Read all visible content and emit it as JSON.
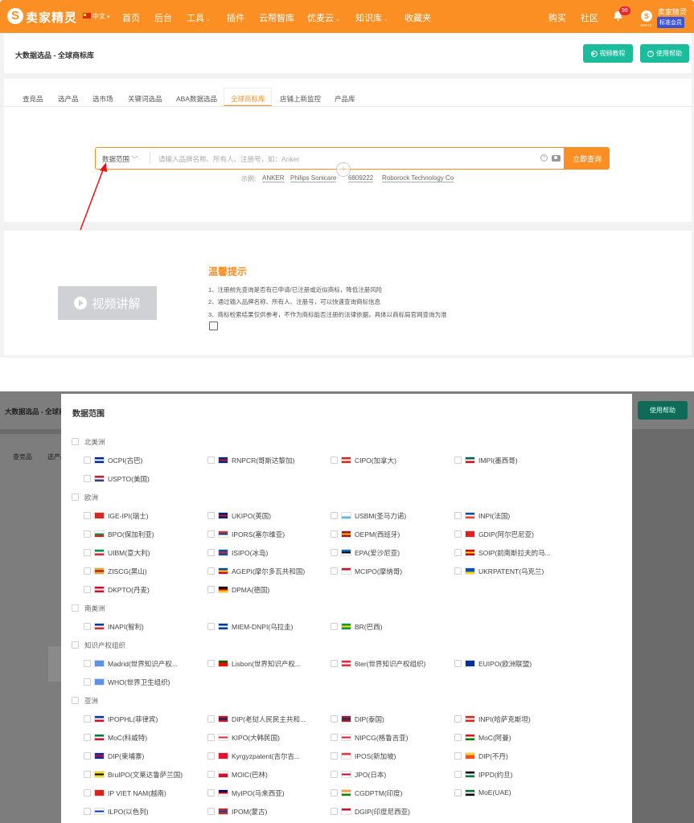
{
  "nav": {
    "logo_mark": "S",
    "logo_text": "卖家精灵",
    "language": "中文",
    "items": [
      "首页",
      "后台",
      "工具",
      "插件",
      "云帮智库",
      "优麦云",
      "知识库",
      "收藏夹"
    ],
    "right_items": [
      "购买",
      "社区"
    ],
    "notification_count": "99",
    "seller_logo_text": "SPRITE",
    "user_name": "卖家精灵",
    "member_badge": "标准会员"
  },
  "page": {
    "breadcrumb": "大数据选品 - 全球商标库",
    "btn_tutorial": "视频教程",
    "btn_help": "使用帮助",
    "tabs": [
      "查竞品",
      "选产品",
      "选市场",
      "关键词选品",
      "ABA数据选品",
      "全球商标库",
      "店铺上新监控",
      "产品库"
    ],
    "active_tab": "全球商标库"
  },
  "search": {
    "scope_label": "数据范围",
    "placeholder": "请输入品牌名称、所有人、注册号，如：Anker",
    "button": "立即查询",
    "examples_label": "示例:",
    "examples": [
      "ANKER",
      "Philips Sonicare",
      "6809222",
      "Roborock Technology Co"
    ]
  },
  "lower": {
    "video_label": "视频讲解",
    "tips_title": "温馨提示",
    "tips": [
      "1、注册前先查询是否有已申请/已注册或近似商标，降低注册风险",
      "2、通过输入品牌名称、所有人、注册号，可以快速查询商标信息",
      "3、商标检索结果仅供参考，不作为商标能否注册的法律依据，具体以商标局官网查询为准"
    ]
  },
  "modal": {
    "title": "数据范围",
    "groups": [
      {
        "name": "北美洲",
        "items": [
          {
            "label": "OCPI(古巴)",
            "flag": [
              "#002a8f",
              "#fff",
              "#002a8f"
            ]
          },
          {
            "label": "RNPCR(哥斯达黎加)",
            "flag": [
              "#002b7f",
              "#ce1126",
              "#002b7f"
            ]
          },
          {
            "label": "CIPO(加拿大)",
            "flag": [
              "#d52b1e",
              "#fff",
              "#d52b1e"
            ]
          },
          {
            "label": "IMPI(墨西哥)",
            "flag": [
              "#006847",
              "#fff",
              "#ce1126"
            ]
          },
          {
            "label": "USPTO(美国)",
            "flag": [
              "#b22234",
              "#fff",
              "#3c3b6e"
            ]
          }
        ]
      },
      {
        "name": "欧洲",
        "items": [
          {
            "label": "IGE-IPI(瑞士)",
            "flag": [
              "#d52b1e",
              "#d52b1e",
              "#d52b1e"
            ]
          },
          {
            "label": "UKIPO(英国)",
            "flag": [
              "#012169",
              "#c8102e",
              "#012169"
            ]
          },
          {
            "label": "USBM(圣马力诺)",
            "flag": [
              "#fff",
              "#fff",
              "#5eb6e4"
            ]
          },
          {
            "label": "INPI(法国)",
            "flag": [
              "#0055a4",
              "#fff",
              "#ef4135"
            ]
          },
          {
            "label": "BPO(保加利亚)",
            "flag": [
              "#fff",
              "#00966e",
              "#d62612"
            ]
          },
          {
            "label": "IPORS(塞尔维亚)",
            "flag": [
              "#c6363c",
              "#0c4076",
              "#fff"
            ]
          },
          {
            "label": "OEPM(西班牙)",
            "flag": [
              "#aa151b",
              "#f1bf00",
              "#aa151b"
            ]
          },
          {
            "label": "GDIP(阿尔巴尼亚)",
            "flag": [
              "#e41e20",
              "#e41e20",
              "#e41e20"
            ]
          },
          {
            "label": "UIBM(意大利)",
            "flag": [
              "#009246",
              "#fff",
              "#ce2b37"
            ]
          },
          {
            "label": "ISIPO(冰岛)",
            "flag": [
              "#02529c",
              "#dc1e35",
              "#02529c"
            ]
          },
          {
            "label": "EPA(爱沙尼亚)",
            "flag": [
              "#0072ce",
              "#000",
              "#fff"
            ]
          },
          {
            "label": "SOIP(前南斯拉夫的马...",
            "flag": [
              "#d20000",
              "#ffe600",
              "#d20000"
            ]
          },
          {
            "label": "ZISCG(黑山)",
            "flag": [
              "#d3ae3b",
              "#c40308",
              "#d3ae3b"
            ]
          },
          {
            "label": "AGEPI(摩尔多瓦共和国)",
            "flag": [
              "#0046ae",
              "#ffd200",
              "#cc092f"
            ]
          },
          {
            "label": "MCIPO(摩纳哥)",
            "flag": [
              "#ce1126",
              "#fff",
              "#fff"
            ]
          },
          {
            "label": "UKRPATENT(乌克兰)",
            "flag": [
              "#0057b7",
              "#0057b7",
              "#ffd700"
            ]
          },
          {
            "label": "DKPTO(丹麦)",
            "flag": [
              "#c8102e",
              "#fff",
              "#c8102e"
            ]
          },
          {
            "label": "DPMA(德国)",
            "flag": [
              "#000",
              "#dd0000",
              "#ffce00"
            ]
          }
        ]
      },
      {
        "name": "南美洲",
        "items": [
          {
            "label": "INAPI(智利)",
            "flag": [
              "#0039a6",
              "#fff",
              "#d52b1e"
            ]
          },
          {
            "label": "MIEM-DNPI(乌拉圭)",
            "flag": [
              "#0038a8",
              "#fff",
              "#0038a8"
            ]
          },
          {
            "label": "BR(巴西)",
            "flag": [
              "#009c3b",
              "#ffdf00",
              "#009c3b"
            ]
          }
        ]
      },
      {
        "name": "知识产权组织",
        "items": [
          {
            "label": "Madrid(世界知识产权...",
            "flag": [
              "#5b92e5",
              "#5b92e5",
              "#5b92e5"
            ]
          },
          {
            "label": "Lisbon(世界知识产权...",
            "flag": [
              "#006600",
              "#ff0000",
              "#ff0000"
            ]
          },
          {
            "label": "6ter(世界知识产权组织)",
            "flag": [
              "#ed2939",
              "#fff",
              "#ed2939"
            ]
          },
          {
            "label": "EUIPO(欧洲联盟)",
            "flag": [
              "#003399",
              "#003399",
              "#003399"
            ]
          },
          {
            "label": "WHO(世界卫生组织)",
            "flag": [
              "#5b92e5",
              "#5b92e5",
              "#5b92e5"
            ]
          }
        ]
      },
      {
        "name": "亚洲",
        "items": [
          {
            "label": "IPOPHL(菲律宾)",
            "flag": [
              "#0038a8",
              "#fff",
              "#ce1126"
            ]
          },
          {
            "label": "DIP(老挝人民民主共和...",
            "flag": [
              "#ce1126",
              "#002868",
              "#ce1126"
            ]
          },
          {
            "label": "DIP(泰国)",
            "flag": [
              "#a51931",
              "#2d2a4a",
              "#a51931"
            ]
          },
          {
            "label": "INPI(哈萨克斯坦)",
            "flag": [
              "#d52b1e",
              "#fff",
              "#d52b1e"
            ]
          },
          {
            "label": "MoC(科威特)",
            "flag": [
              "#007a3d",
              "#fff",
              "#ce1126"
            ]
          },
          {
            "label": "KIPO(大韩民国)",
            "flag": [
              "#fff",
              "#cd2e3a",
              "#fff"
            ]
          },
          {
            "label": "NIPCG(格鲁吉亚)",
            "flag": [
              "#fff",
              "#e8112d",
              "#fff"
            ]
          },
          {
            "label": "MoC(阿曼)",
            "flag": [
              "#db161b",
              "#fff",
              "#008000"
            ]
          },
          {
            "label": "DIP(柬埔寨)",
            "flag": [
              "#032ea1",
              "#e00025",
              "#032ea1"
            ]
          },
          {
            "label": "Kyrgyzpatent(吉尔吉...",
            "flag": [
              "#e8112d",
              "#e8112d",
              "#e8112d"
            ]
          },
          {
            "label": "IPOS(新加坡)",
            "flag": [
              "#ef3340",
              "#fff",
              "#fff"
            ]
          },
          {
            "label": "DIP(不丹)",
            "flag": [
              "#ffd520",
              "#ff4e12",
              "#ff4e12"
            ]
          },
          {
            "label": "BruIPO(文莱达鲁萨兰国)",
            "flag": [
              "#f7e017",
              "#000",
              "#f7e017"
            ]
          },
          {
            "label": "MOIC(巴林)",
            "flag": [
              "#fff",
              "#ce1126",
              "#ce1126"
            ]
          },
          {
            "label": "JPO(日本)",
            "flag": [
              "#fff",
              "#bc002d",
              "#fff"
            ]
          },
          {
            "label": "IPPD(约旦)",
            "flag": [
              "#000",
              "#fff",
              "#007a3d"
            ]
          },
          {
            "label": "IP VIET NAM(越南)",
            "flag": [
              "#da251d",
              "#da251d",
              "#da251d"
            ]
          },
          {
            "label": "MyIPO(马来西亚)",
            "flag": [
              "#010066",
              "#cc0001",
              "#fff"
            ]
          },
          {
            "label": "CGDPTM(印度)",
            "flag": [
              "#ff9933",
              "#fff",
              "#138808"
            ]
          },
          {
            "label": "MoE(UAE)",
            "flag": [
              "#00732f",
              "#fff",
              "#000"
            ]
          },
          {
            "label": "ILPO(以色列)",
            "flag": [
              "#fff",
              "#0038b8",
              "#fff"
            ]
          },
          {
            "label": "IPOM(蒙古)",
            "flag": [
              "#c4272f",
              "#015197",
              "#c4272f"
            ]
          },
          {
            "label": "DGIP(印度尼西亚)",
            "flag": [
              "#ce1126",
              "#fff",
              "#fff"
            ]
          }
        ]
      }
    ]
  },
  "colors": {
    "brand": "#fb8f23",
    "green": "#1abc9c",
    "member": "#3c54d6"
  }
}
